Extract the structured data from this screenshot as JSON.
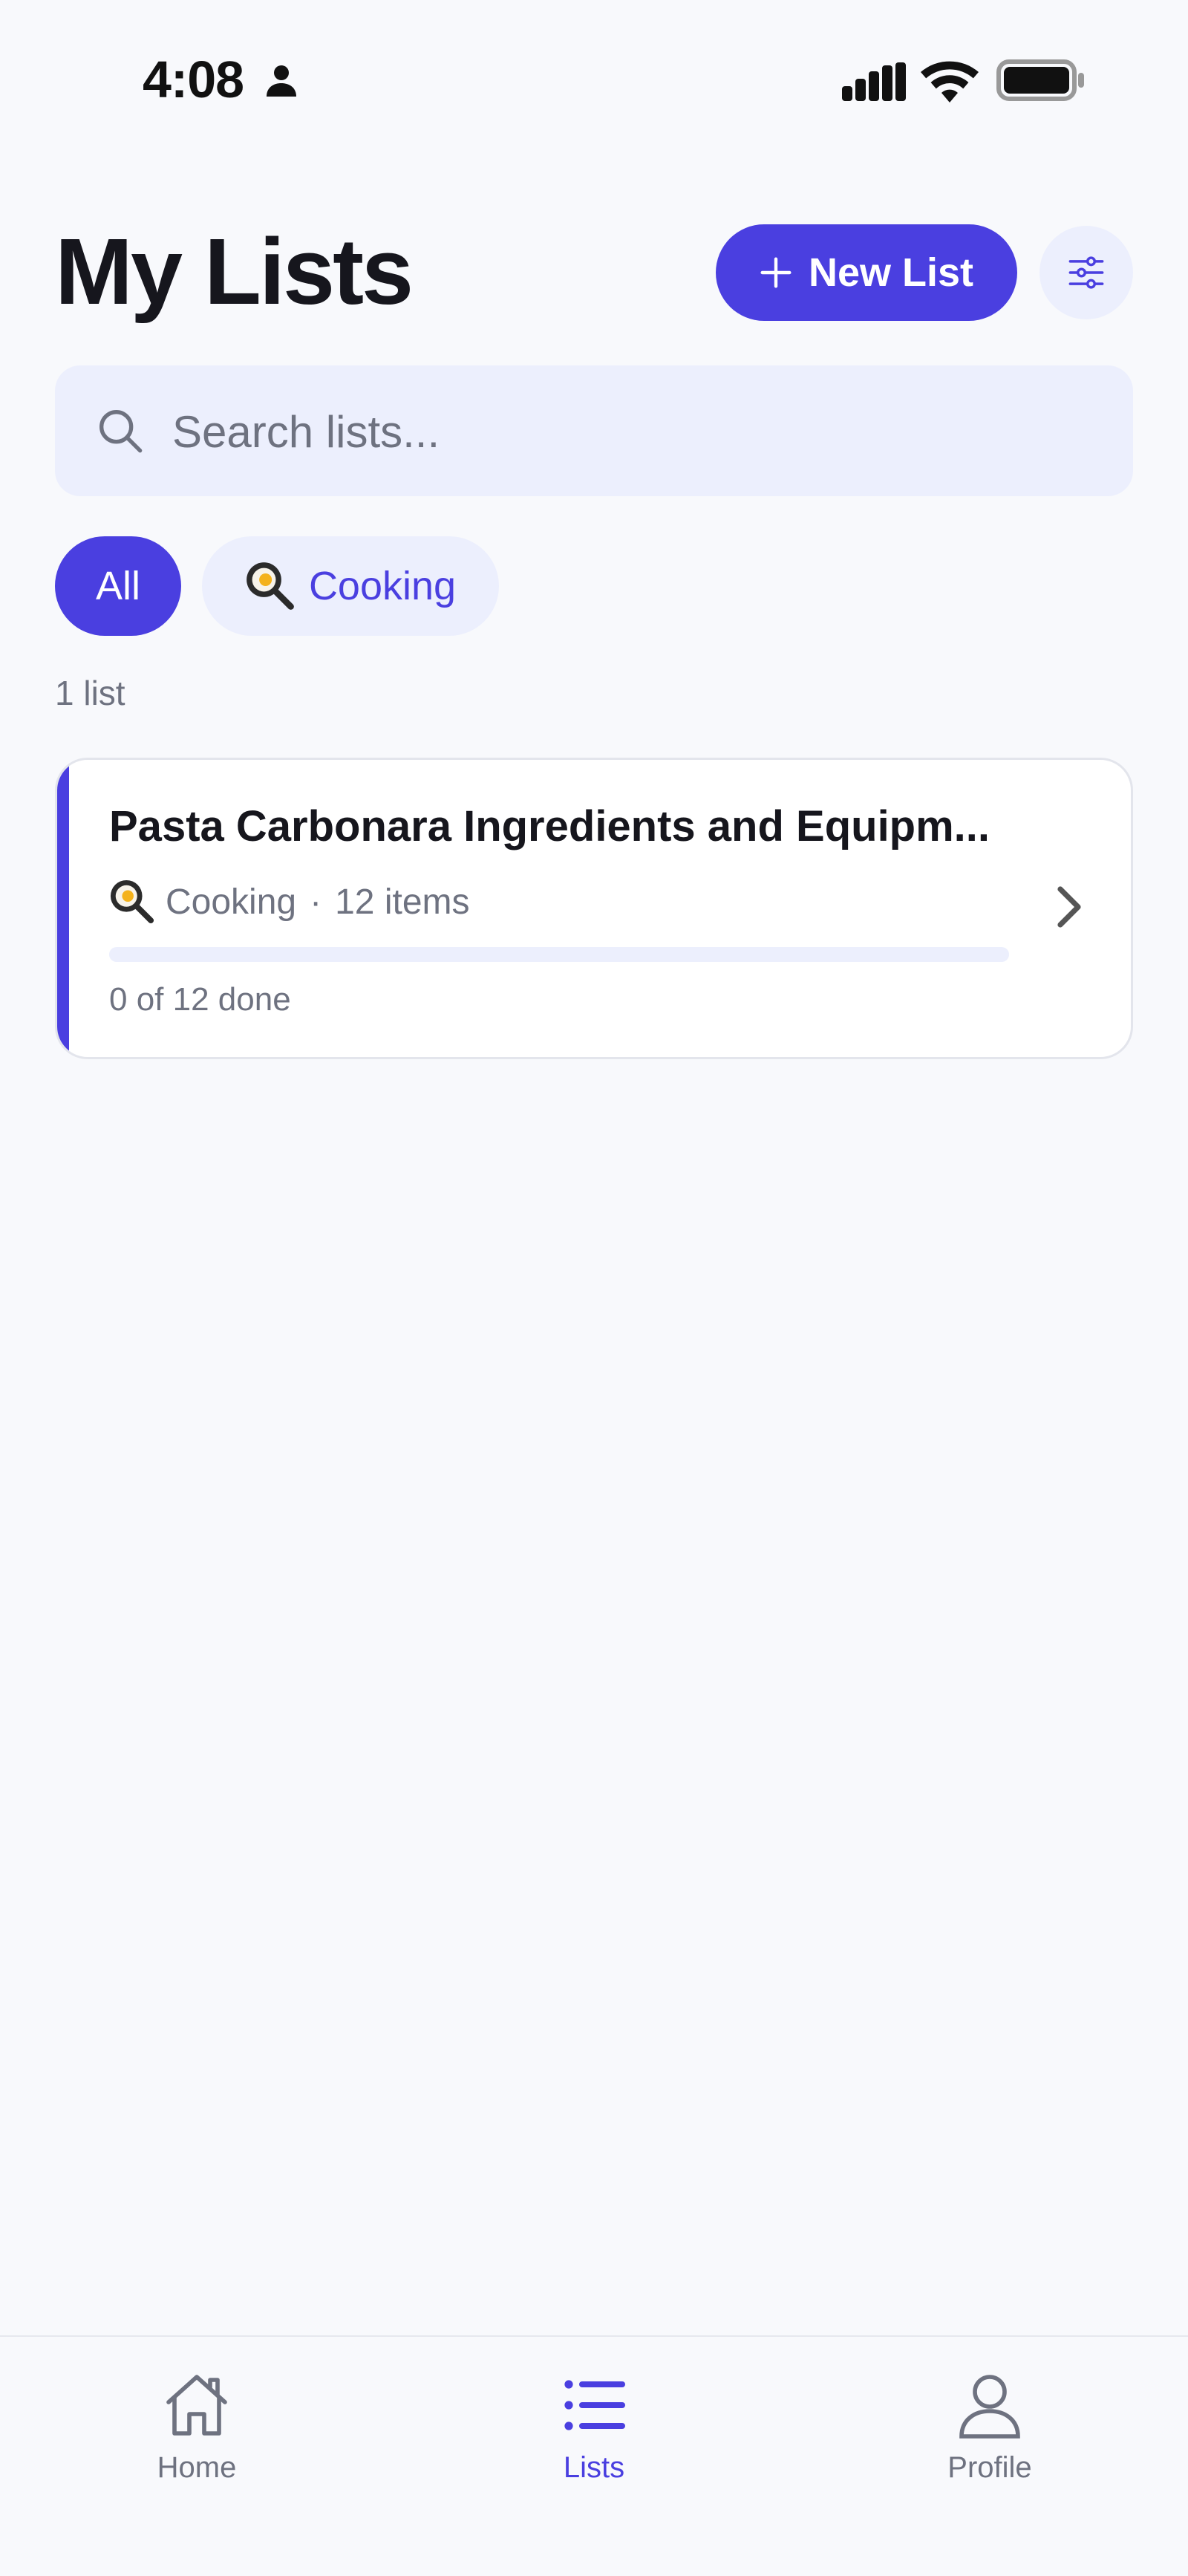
{
  "status_bar": {
    "time": "4:08",
    "icons": [
      "person-icon",
      "cellular-signal-icon",
      "wifi-icon",
      "battery-icon"
    ]
  },
  "header": {
    "title": "My Lists",
    "new_list_label": "New List",
    "new_list_icon": "plus-icon",
    "filter_icon": "sliders-icon"
  },
  "search": {
    "placeholder": "Search lists...",
    "value": "",
    "icon": "search-icon"
  },
  "filters": {
    "chips": [
      {
        "label": "All",
        "selected": true
      },
      {
        "label": "Cooking",
        "icon": "frying-pan-emoji",
        "selected": false
      }
    ]
  },
  "list_count": "1 list",
  "lists": [
    {
      "title": "Pasta Carbonara Ingredients and Equipm...",
      "category": "Cooking",
      "category_icon": "frying-pan-emoji",
      "separator": "·",
      "item_count": "12 items",
      "progress_text": "0 of 12 done",
      "progress_fraction": 0,
      "accent_color": "#4a3fe0"
    }
  ],
  "bottom_nav": {
    "items": [
      {
        "label": "Home",
        "icon": "home-icon",
        "active": false
      },
      {
        "label": "Lists",
        "icon": "list-icon",
        "active": true
      },
      {
        "label": "Profile",
        "icon": "user-icon",
        "active": false
      }
    ]
  },
  "colors": {
    "accent": "#4a3fe0",
    "chip_bg": "#eceffd",
    "background": "#f8f9fc",
    "muted_text": "#6e7280"
  }
}
